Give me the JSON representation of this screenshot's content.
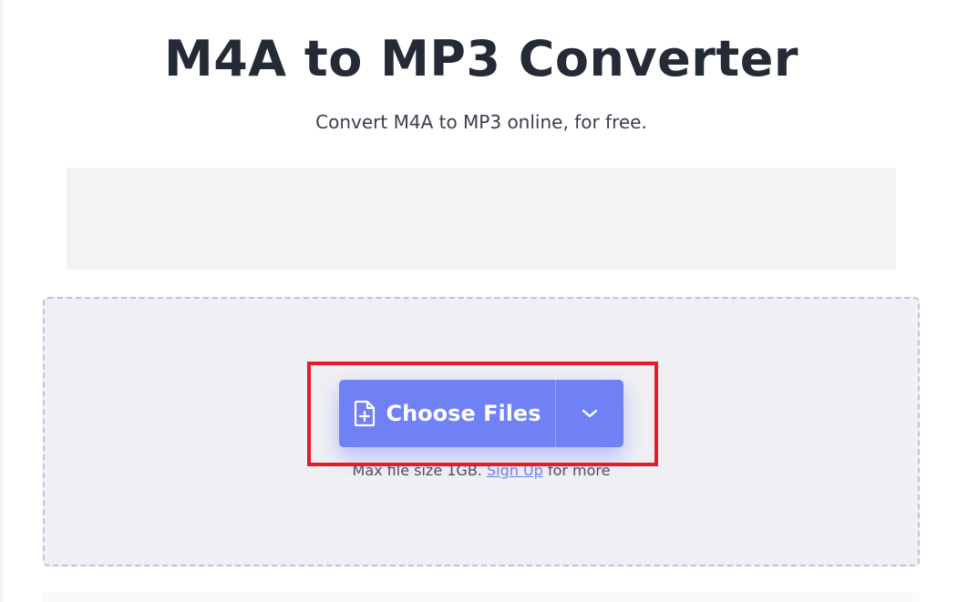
{
  "header": {
    "title": "M4A to MP3 Converter",
    "subtitle": "Convert M4A to MP3 online, for free."
  },
  "upload": {
    "choose_label": "Choose Files",
    "dropdown_icon": "chevron-down-icon",
    "file_icon": "file-plus-icon",
    "max_size_prefix": "Max file size 1GB.",
    "sign_up_link": "Sign Up",
    "max_size_suffix": "for more"
  },
  "colors": {
    "accent": "#7080f5",
    "highlight": "#e21d2b",
    "title": "#252b36",
    "drop_zone_bg": "#efeff4"
  }
}
